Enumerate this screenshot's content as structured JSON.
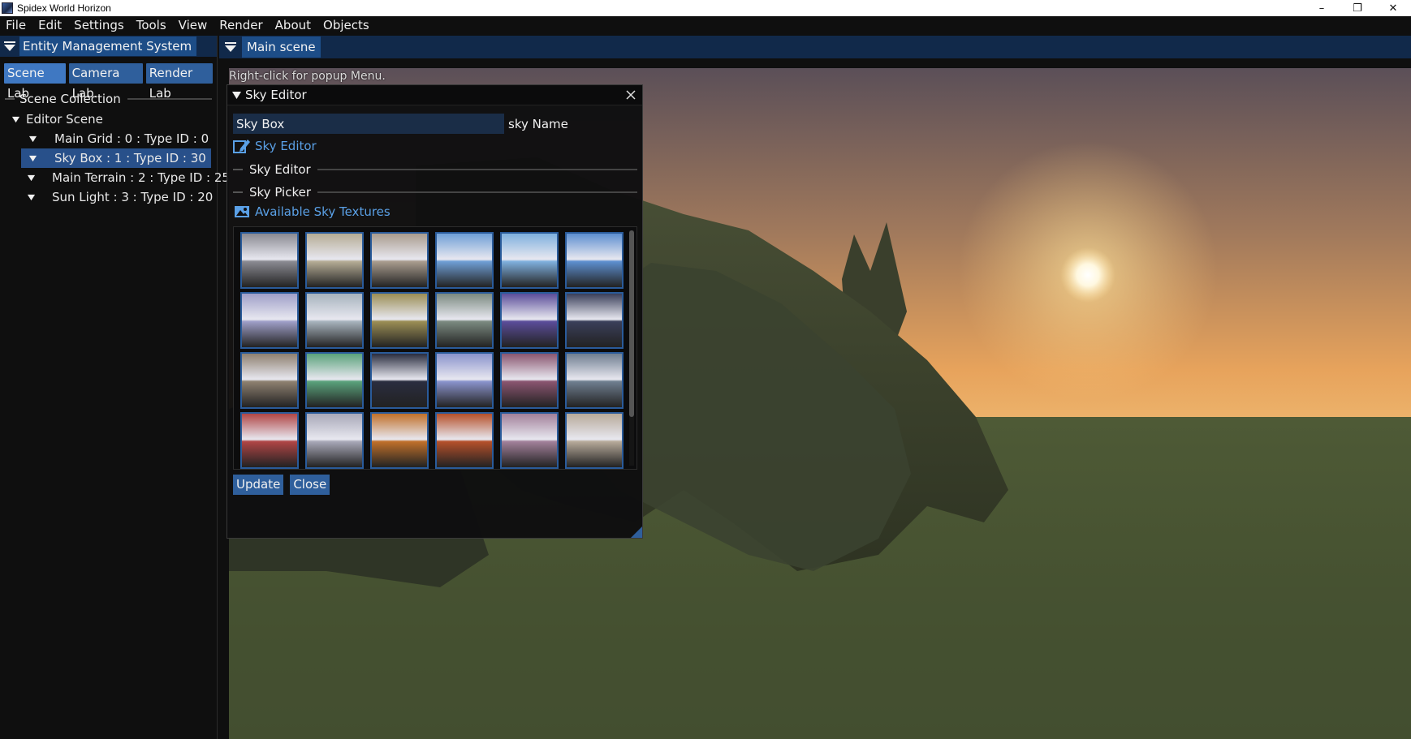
{
  "window": {
    "title": "Spidex World Horizon",
    "minimize": "–",
    "restore": "❐",
    "close": "✕"
  },
  "menu": [
    "File",
    "Edit",
    "Settings",
    "Tools",
    "View",
    "Render",
    "About",
    "Objects"
  ],
  "left_panel": {
    "title": "Entity Management System",
    "tabs": [
      "Scene Lab",
      "Camera Lab.",
      "Render Lab"
    ],
    "section": "Scene Collection",
    "tree": {
      "root": "Editor Scene",
      "items": [
        {
          "label": "Main Grid : 0 : Type ID : 0"
        },
        {
          "label": "Sky Box : 1 : Type ID : 30",
          "selected": true
        },
        {
          "label": "Main Terrain : 2 : Type ID : 25"
        },
        {
          "label": "Sun Light : 3 : Type ID : 20"
        }
      ]
    }
  },
  "main": {
    "tab": "Main scene",
    "hint": "Right-click for popup Menu."
  },
  "sky_editor": {
    "title": "Sky Editor",
    "name_value": "Sky Box",
    "name_label": "sky Name",
    "link_label": "Sky Editor",
    "section1": "Sky Editor",
    "section2": "Sky Picker",
    "textures_label": "Available Sky Textures",
    "update_button": "Update",
    "close_button": "Close"
  },
  "colors": {
    "accent": "#3f78c2",
    "header_bg": "#11294a",
    "link": "#5aa0e6",
    "thumb_border": "#2a5b9a"
  },
  "thumbnails": [
    "#8a8a92",
    "#b5ac95",
    "#a99c8e",
    "#6f9fd6",
    "#7fb0de",
    "#5d8fd0",
    "#9f9fc8",
    "#a7b3bd",
    "#9b8e55",
    "#7b8a80",
    "#5b4d9a",
    "#3a3f5a",
    "#8e8070",
    "#5aa27b",
    "#2a2d3f",
    "#8a93cc",
    "#8a5570",
    "#6f7e90",
    "#b04545",
    "#a8a8b8",
    "#c0702a",
    "#b5502a",
    "#a2809a",
    "#b7aa9a"
  ]
}
